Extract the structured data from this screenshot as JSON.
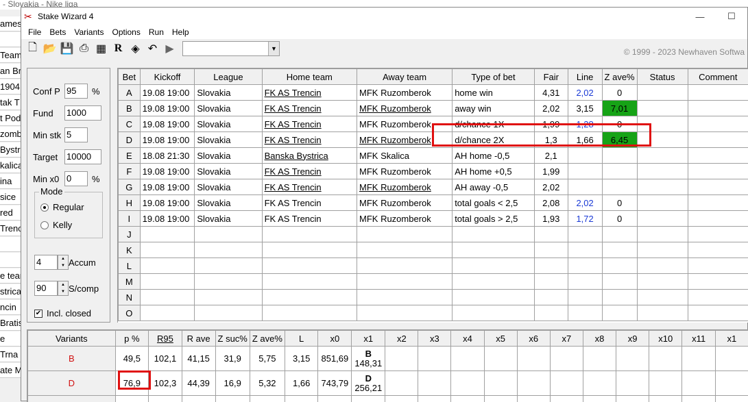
{
  "background_window": {
    "title": "- Slovakia - Nike liga",
    "strip_rows": [
      "ames",
      "",
      "Team",
      "an Br",
      "1904",
      "tak T",
      "t Pod",
      "zomb",
      "Bystri",
      "kalica",
      "ina",
      "sice",
      "red",
      "Trenc",
      "",
      "",
      "e team",
      "strica",
      "ncin",
      "Bratis",
      "e",
      "Trna",
      "ate M"
    ]
  },
  "window": {
    "title": "Stake Wizard 4",
    "controls": [
      "minimize-icon",
      "maximize-icon"
    ]
  },
  "menu": [
    "File",
    "Bets",
    "Variants",
    "Options",
    "Run",
    "Help"
  ],
  "toolbar": {
    "icons": [
      "new-file-icon",
      "open-folder-icon",
      "save-icon",
      "print-icon",
      "calculator-icon",
      "r-icon",
      "refresh-icon",
      "undo-icon",
      "run-icon"
    ],
    "combo_value": "",
    "copyright": "© 1999 - 2023 Newhaven Softwa"
  },
  "settings": {
    "conf_p": {
      "label": "Conf P",
      "value": "95",
      "unit": "%"
    },
    "fund": {
      "label": "Fund",
      "value": "1000"
    },
    "min_stk": {
      "label": "Min stk",
      "value": "5"
    },
    "target": {
      "label": "Target",
      "value": "10000"
    },
    "min_x0": {
      "label": "Min x0",
      "value": "0",
      "unit": "%"
    },
    "mode": {
      "label": "Mode",
      "options": [
        "Regular",
        "Kelly"
      ],
      "selected": "Regular"
    },
    "accum": {
      "value": "4",
      "label": "Accum"
    },
    "scomp": {
      "value": "90",
      "label": "S/comp"
    },
    "incl_closed": {
      "label": "Incl. closed",
      "checked": true
    }
  },
  "bets": {
    "columns": [
      "Bet",
      "Kickoff",
      "League",
      "Home team",
      "Away team",
      "Type of bet",
      "Fair",
      "Line",
      "Z ave%",
      "Status",
      "Comment"
    ],
    "rows": [
      {
        "bet": "A",
        "kickoff": "19.08 19:00",
        "league": "Slovakia",
        "home": "FK AS Trencin",
        "home_ul": true,
        "away": "MFK Ruzomberok",
        "away_ul": false,
        "type": "home win",
        "fair": "4,31",
        "line": "2,02",
        "line_blue": true,
        "zave": "0",
        "zave_green": false
      },
      {
        "bet": "B",
        "kickoff": "19.08 19:00",
        "league": "Slovakia",
        "home": "FK AS Trencin",
        "home_ul": true,
        "away": "MFK Ruzomberok",
        "away_ul": true,
        "type": "away win",
        "fair": "2,02",
        "line": "3,15",
        "line_blue": false,
        "zave": "7,01",
        "zave_green": true
      },
      {
        "bet": "C",
        "kickoff": "19.08 19:00",
        "league": "Slovakia",
        "home": "FK AS Trencin",
        "home_ul": true,
        "away": "MFK Ruzomberok",
        "away_ul": false,
        "type": "d/chance 1X",
        "fair": "1,99",
        "line": "1,28",
        "line_blue": true,
        "zave": "0",
        "zave_green": false
      },
      {
        "bet": "D",
        "kickoff": "19.08 19:00",
        "league": "Slovakia",
        "home": "FK AS Trencin",
        "home_ul": true,
        "away": "MFK Ruzomberok",
        "away_ul": true,
        "type": "d/chance 2X",
        "fair": "1,3",
        "line": "1,66",
        "line_blue": false,
        "zave": "6,45",
        "zave_green": true
      },
      {
        "bet": "E",
        "kickoff": "18.08 21:30",
        "league": "Slovakia",
        "home": "Banska Bystrica",
        "home_ul": true,
        "away": "MFK Skalica",
        "away_ul": false,
        "type": "AH home -0,5",
        "fair": "2,1",
        "line": "",
        "line_blue": false,
        "zave": "",
        "zave_green": false
      },
      {
        "bet": "F",
        "kickoff": "19.08 19:00",
        "league": "Slovakia",
        "home": "FK AS Trencin",
        "home_ul": true,
        "away": "MFK Ruzomberok",
        "away_ul": false,
        "type": "AH home +0,5",
        "fair": "1,99",
        "line": "",
        "line_blue": false,
        "zave": "",
        "zave_green": false
      },
      {
        "bet": "G",
        "kickoff": "19.08 19:00",
        "league": "Slovakia",
        "home": "FK AS Trencin",
        "home_ul": true,
        "away": "MFK Ruzomberok",
        "away_ul": true,
        "type": "AH away -0,5",
        "fair": "2,02",
        "line": "",
        "line_blue": false,
        "zave": "",
        "zave_green": false
      },
      {
        "bet": "H",
        "kickoff": "19.08 19:00",
        "league": "Slovakia",
        "home": "FK AS Trencin",
        "home_ul": false,
        "away": "MFK Ruzomberok",
        "away_ul": false,
        "type": "total goals < 2,5",
        "fair": "2,08",
        "line": "2,02",
        "line_blue": true,
        "zave": "0",
        "zave_green": false
      },
      {
        "bet": "I",
        "kickoff": "19.08 19:00",
        "league": "Slovakia",
        "home": "FK AS Trencin",
        "home_ul": false,
        "away": "MFK Ruzomberok",
        "away_ul": false,
        "type": "total goals > 2,5",
        "fair": "1,93",
        "line": "1,72",
        "line_blue": true,
        "zave": "0",
        "zave_green": false
      },
      {
        "bet": "J"
      },
      {
        "bet": "K"
      },
      {
        "bet": "L"
      },
      {
        "bet": "M"
      },
      {
        "bet": "N"
      },
      {
        "bet": "O"
      }
    ]
  },
  "variants": {
    "columns": [
      "Variants",
      "p %",
      "R95",
      "R ave",
      "Z suc%",
      "Z ave%",
      "L",
      "x0",
      "x1",
      "x2",
      "x3",
      "x4",
      "x5",
      "x6",
      "x7",
      "x8",
      "x9",
      "x10",
      "x11",
      "x1"
    ],
    "rows": [
      {
        "name": "B",
        "p": "49,5",
        "r95": "102,1",
        "rave": "41,15",
        "zsuc": "31,9",
        "zave": "5,75",
        "l": "3,15",
        "x0": "851,69",
        "x1_bet": "B",
        "x1_val": "148,31"
      },
      {
        "name": "D",
        "p": "76,9",
        "r95": "102,3",
        "rave": "44,39",
        "zsuc": "16,9",
        "zave": "5,32",
        "l": "1,66",
        "x0": "743,79",
        "x1_bet": "D",
        "x1_val": "256,21"
      }
    ]
  },
  "colors": {
    "highlight_red": "#e01010",
    "zave_green": "#16a316",
    "line_blue": "#1a3ad6",
    "variant_red": "#d01010"
  }
}
